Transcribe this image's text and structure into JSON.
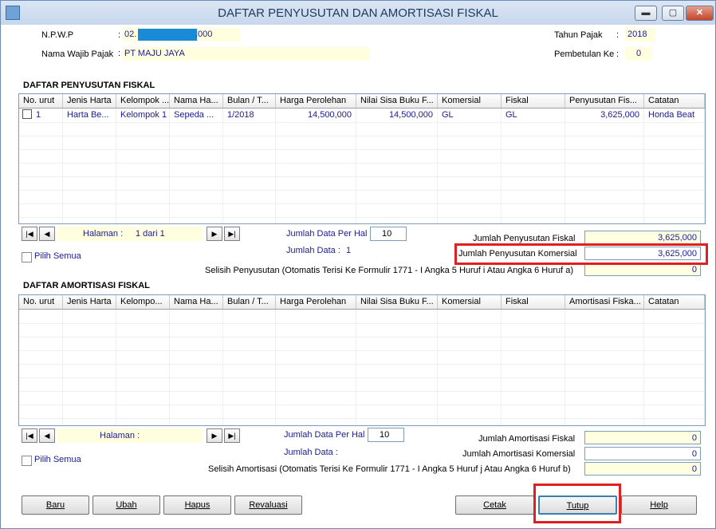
{
  "window": {
    "title": "DAFTAR PENYUSUTAN DAN AMORTISASI FISKAL",
    "minimize": "▬",
    "maximize": "▢",
    "close": "✕"
  },
  "header": {
    "npwp_label": "N.P.W.P",
    "npwp_prefix": "02.",
    "npwp_suffix": ".000",
    "nama_label": "Nama Wajib Pajak",
    "nama_value": "PT MAJU JAYA",
    "tahun_label": "Tahun Pajak",
    "tahun_value": "2018",
    "pembetulan_label": "Pembetulan Ke",
    "pembetulan_value": "0",
    "colon": ":"
  },
  "penyusutan": {
    "section_title": "DAFTAR PENYUSUTAN FISKAL",
    "columns": [
      "No. urut",
      "Jenis Harta",
      "Kelompok ...",
      "Nama Ha...",
      "Bulan / T...",
      "Harga Perolehan",
      "Nilai Sisa Buku F...",
      "Komersial",
      "Fiskal",
      "Penyusutan Fis...",
      "Catatan"
    ],
    "rows": [
      [
        "1",
        "Harta Be...",
        "Kelompok 1",
        "Sepeda ...",
        "1/2018",
        "14,500,000",
        "14,500,000",
        "GL",
        "GL",
        "3,625,000",
        "Honda Beat"
      ]
    ],
    "halaman_label": "Halaman :",
    "halaman_value": "1  dari  1",
    "per_hal_label": "Jumlah Data Per Hal :",
    "per_hal_value": "10",
    "jumlah_data_label": "Jumlah Data :",
    "jumlah_data_value": "1",
    "pilih_semua": "Pilih Semua",
    "jumlah_fiskal_label": "Jumlah Penyusutan Fiskal",
    "jumlah_fiskal_value": "3,625,000",
    "jumlah_komersial_label": "Jumlah Penyusutan Komersial",
    "jumlah_komersial_value": "3,625,000",
    "selisih_label": "Selisih Penyusutan (Otomatis Terisi Ke Formulir 1771 - I Angka 5 Huruf i Atau Angka 6 Huruf a)",
    "selisih_value": "0"
  },
  "amortisasi": {
    "section_title": "DAFTAR AMORTISASI FISKAL",
    "columns": [
      "No. urut",
      "Jenis Harta",
      "Kelompo...",
      "Nama Ha...",
      "Bulan / T...",
      "Harga Perolehan",
      "Nilai Sisa Buku F...",
      "Komersial",
      "Fiskal",
      "Amortisasi Fiska...",
      "Catatan"
    ],
    "halaman_label": "Halaman :",
    "per_hal_label": "Jumlah Data Per Hal :",
    "per_hal_value": "10",
    "jumlah_data_label": "Jumlah Data :",
    "pilih_semua": "Pilih Semua",
    "jumlah_fiskal_label": "Jumlah Amortisasi Fiskal",
    "jumlah_fiskal_value": "0",
    "jumlah_komersial_label": "Jumlah Amortisasi Komersial",
    "jumlah_komersial_value": "0",
    "selisih_label": "Selisih Amortisasi (Otomatis Terisi Ke Formulir 1771 - I Angka 5 Huruf j Atau Angka 6 Huruf b)",
    "selisih_value": "0"
  },
  "nav": {
    "first": "|◀",
    "prev": "◀",
    "next": "▶",
    "last": "▶|"
  },
  "buttons": {
    "baru": "Baru",
    "ubah": "Ubah",
    "hapus": "Hapus",
    "revaluasi": "Revaluasi",
    "cetak": "Cetak",
    "tutup": "Tutup",
    "help": "Help"
  },
  "colors": {
    "highlight": "#e02020",
    "field": "#ffffe0",
    "value_text": "#1a1a9a"
  }
}
